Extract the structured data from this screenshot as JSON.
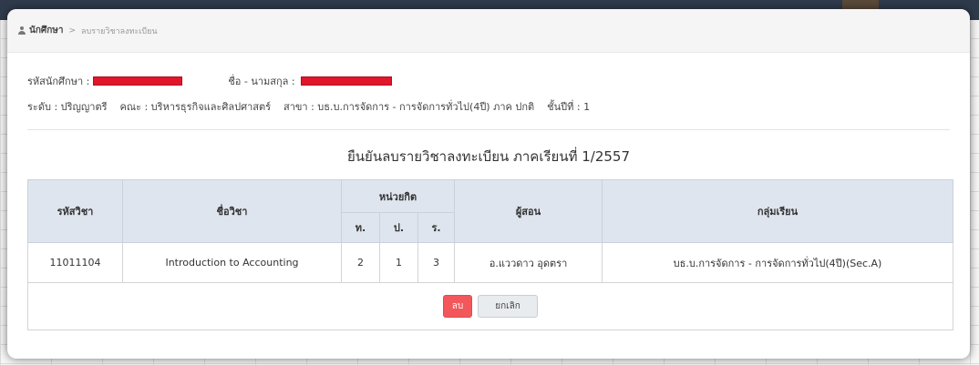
{
  "breadcrumb": {
    "root": "นักศึกษา",
    "separator": ">",
    "current": "ลบรายวิชาลงทะเบียน"
  },
  "student": {
    "id_label": "รหัสนักศึกษา :",
    "name_label": "ชื่อ - นามสกุล :",
    "level": "ระดับ : ปริญญาตรี",
    "faculty": "คณะ : บริหารธุรกิจและศิลปศาสตร์",
    "major": "สาขา : บธ.บ.การจัดการ - การจัดการทั่วไป(4ปี) ภาค ปกติ",
    "year": "ชั้นปีที่ : 1"
  },
  "confirm_title": "ยืนยันลบรายวิชาลงทะเบียน ภาคเรียนที่ 1/2557",
  "table": {
    "headers": {
      "code": "รหัสวิชา",
      "name": "ชื่อวิชา",
      "credits": "หน่วยกิต",
      "credit_sub": [
        "ท.",
        "ป.",
        "ร."
      ],
      "instructor": "ผู้สอน",
      "group": "กลุ่มเรียน"
    },
    "rows": [
      {
        "code": "11011104",
        "name": "Introduction to Accounting",
        "t": "2",
        "p": "1",
        "r": "3",
        "instructor": "อ.แววดาว อุดตรา",
        "group": "บธ.บ.การจัดการ - การจัดการทั่วไป(4ปี)(Sec.A)"
      }
    ]
  },
  "buttons": {
    "delete": "ลบ",
    "cancel": "ยกเลิก"
  },
  "colors": {
    "header_bg": "#dfe5ee",
    "delete_button": "#f2575b",
    "redaction": "#e0162b",
    "topbar": "#2f3b4c"
  }
}
